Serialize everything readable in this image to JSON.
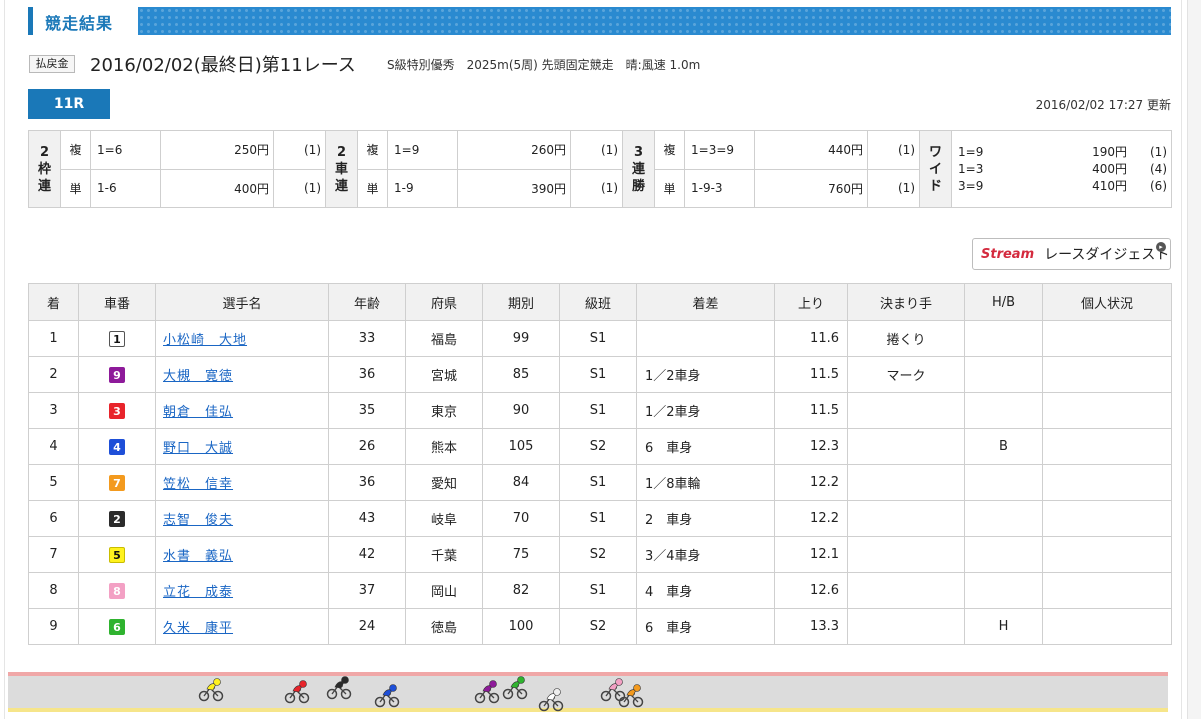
{
  "header": {
    "title": "競走結果"
  },
  "race": {
    "badge": "払戻金",
    "main": "2016/02/02(最終日)第11レース",
    "sub": "S級特別優秀　2025m(5周) 先頭固定競走　晴:風速 1.0m",
    "tab": "11R",
    "updated": "2016/02/02 17:27 更新"
  },
  "payouts": {
    "wakuren": {
      "label": "枠連",
      "rows": [
        {
          "kind": "複",
          "combo": "1=6",
          "amount": "250円",
          "pop": "(1)"
        },
        {
          "kind": "単",
          "combo": "1-6",
          "amount": "400円",
          "pop": "(1)"
        }
      ]
    },
    "shaken": {
      "label": "車連",
      "rows": [
        {
          "kind": "複",
          "combo": "1=9",
          "amount": "260円",
          "pop": "(1)"
        },
        {
          "kind": "単",
          "combo": "1-9",
          "amount": "390円",
          "pop": "(1)"
        }
      ]
    },
    "sanren": {
      "label": "連勝",
      "prefix": "3",
      "rows": [
        {
          "kind": "複",
          "combo": "1=3=9",
          "amount": "440円",
          "pop": "(1)"
        },
        {
          "kind": "単",
          "combo": "1-9-3",
          "amount": "760円",
          "pop": "(1)"
        }
      ]
    },
    "wide": {
      "label": "ワイド",
      "rows": [
        {
          "combo": "1=9",
          "amount": "190円",
          "pop": "(1)"
        },
        {
          "combo": "1=3",
          "amount": "400円",
          "pop": "(4)"
        },
        {
          "combo": "3=9",
          "amount": "410円",
          "pop": "(6)"
        }
      ]
    },
    "wakuren_prefix": "2",
    "shaken_prefix": "2"
  },
  "digest": {
    "logo": "Stream",
    "label": "レースダイジェスト"
  },
  "results": {
    "headers": [
      "着",
      "車番",
      "選手名",
      "年齢",
      "府県",
      "期別",
      "級班",
      "着差",
      "上り",
      "決まり手",
      "H/B",
      "個人状況"
    ],
    "rows": [
      {
        "rank": "1",
        "num": "1",
        "name": "小松崎　大地",
        "age": "33",
        "pref": "福島",
        "term": "99",
        "cls": "S1",
        "margin": "",
        "agari": "11.6",
        "kimari": "捲くり",
        "hb": "",
        "status": ""
      },
      {
        "rank": "2",
        "num": "9",
        "name": "大槻　寛徳",
        "age": "36",
        "pref": "宮城",
        "term": "85",
        "cls": "S1",
        "margin": "1／2車身",
        "agari": "11.5",
        "kimari": "マーク",
        "hb": "",
        "status": ""
      },
      {
        "rank": "3",
        "num": "3",
        "name": "朝倉　佳弘",
        "age": "35",
        "pref": "東京",
        "term": "90",
        "cls": "S1",
        "margin": "1／2車身",
        "agari": "11.5",
        "kimari": "",
        "hb": "",
        "status": ""
      },
      {
        "rank": "4",
        "num": "4",
        "name": "野口　大誠",
        "age": "26",
        "pref": "熊本",
        "term": "105",
        "cls": "S2",
        "margin": "6　車身",
        "agari": "12.3",
        "kimari": "",
        "hb": "B",
        "status": ""
      },
      {
        "rank": "5",
        "num": "7",
        "name": "笠松　信幸",
        "age": "36",
        "pref": "愛知",
        "term": "84",
        "cls": "S1",
        "margin": "1／8車輪",
        "agari": "12.2",
        "kimari": "",
        "hb": "",
        "status": ""
      },
      {
        "rank": "6",
        "num": "2",
        "name": "志智　俊夫",
        "age": "43",
        "pref": "岐阜",
        "term": "70",
        "cls": "S1",
        "margin": "2　車身",
        "agari": "12.2",
        "kimari": "",
        "hb": "",
        "status": ""
      },
      {
        "rank": "7",
        "num": "5",
        "name": "水書　義弘",
        "age": "42",
        "pref": "千葉",
        "term": "75",
        "cls": "S2",
        "margin": "3／4車身",
        "agari": "12.1",
        "kimari": "",
        "hb": "",
        "status": ""
      },
      {
        "rank": "8",
        "num": "8",
        "name": "立花　成泰",
        "age": "37",
        "pref": "岡山",
        "term": "82",
        "cls": "S1",
        "margin": "4　車身",
        "agari": "12.6",
        "kimari": "",
        "hb": "",
        "status": ""
      },
      {
        "rank": "9",
        "num": "6",
        "name": "久米　康平",
        "age": "24",
        "pref": "徳島",
        "term": "100",
        "cls": "S2",
        "margin": "6　車身",
        "agari": "13.3",
        "kimari": "",
        "hb": "H",
        "status": ""
      }
    ]
  },
  "bike_colors": {
    "1": {
      "bg": "#ffffff",
      "fg": "#111111",
      "border": "#555555"
    },
    "2": {
      "bg": "#2b2b2b",
      "fg": "#ffffff",
      "border": "#2b2b2b"
    },
    "3": {
      "bg": "#e8242b",
      "fg": "#ffffff",
      "border": "#e8242b"
    },
    "4": {
      "bg": "#1e4fd8",
      "fg": "#ffffff",
      "border": "#1e4fd8"
    },
    "5": {
      "bg": "#fff21e",
      "fg": "#111111",
      "border": "#c9bd00"
    },
    "6": {
      "bg": "#2fb32f",
      "fg": "#ffffff",
      "border": "#2fb32f"
    },
    "7": {
      "bg": "#f39a1e",
      "fg": "#ffffff",
      "border": "#f39a1e"
    },
    "8": {
      "bg": "#f3a0c4",
      "fg": "#ffffff",
      "border": "#f3a0c4"
    },
    "9": {
      "bg": "#8e1a9a",
      "fg": "#ffffff",
      "border": "#8e1a9a"
    }
  },
  "riders": [
    "5",
    "3",
    "2",
    "4",
    "9",
    "6",
    "1",
    "8",
    "7"
  ]
}
